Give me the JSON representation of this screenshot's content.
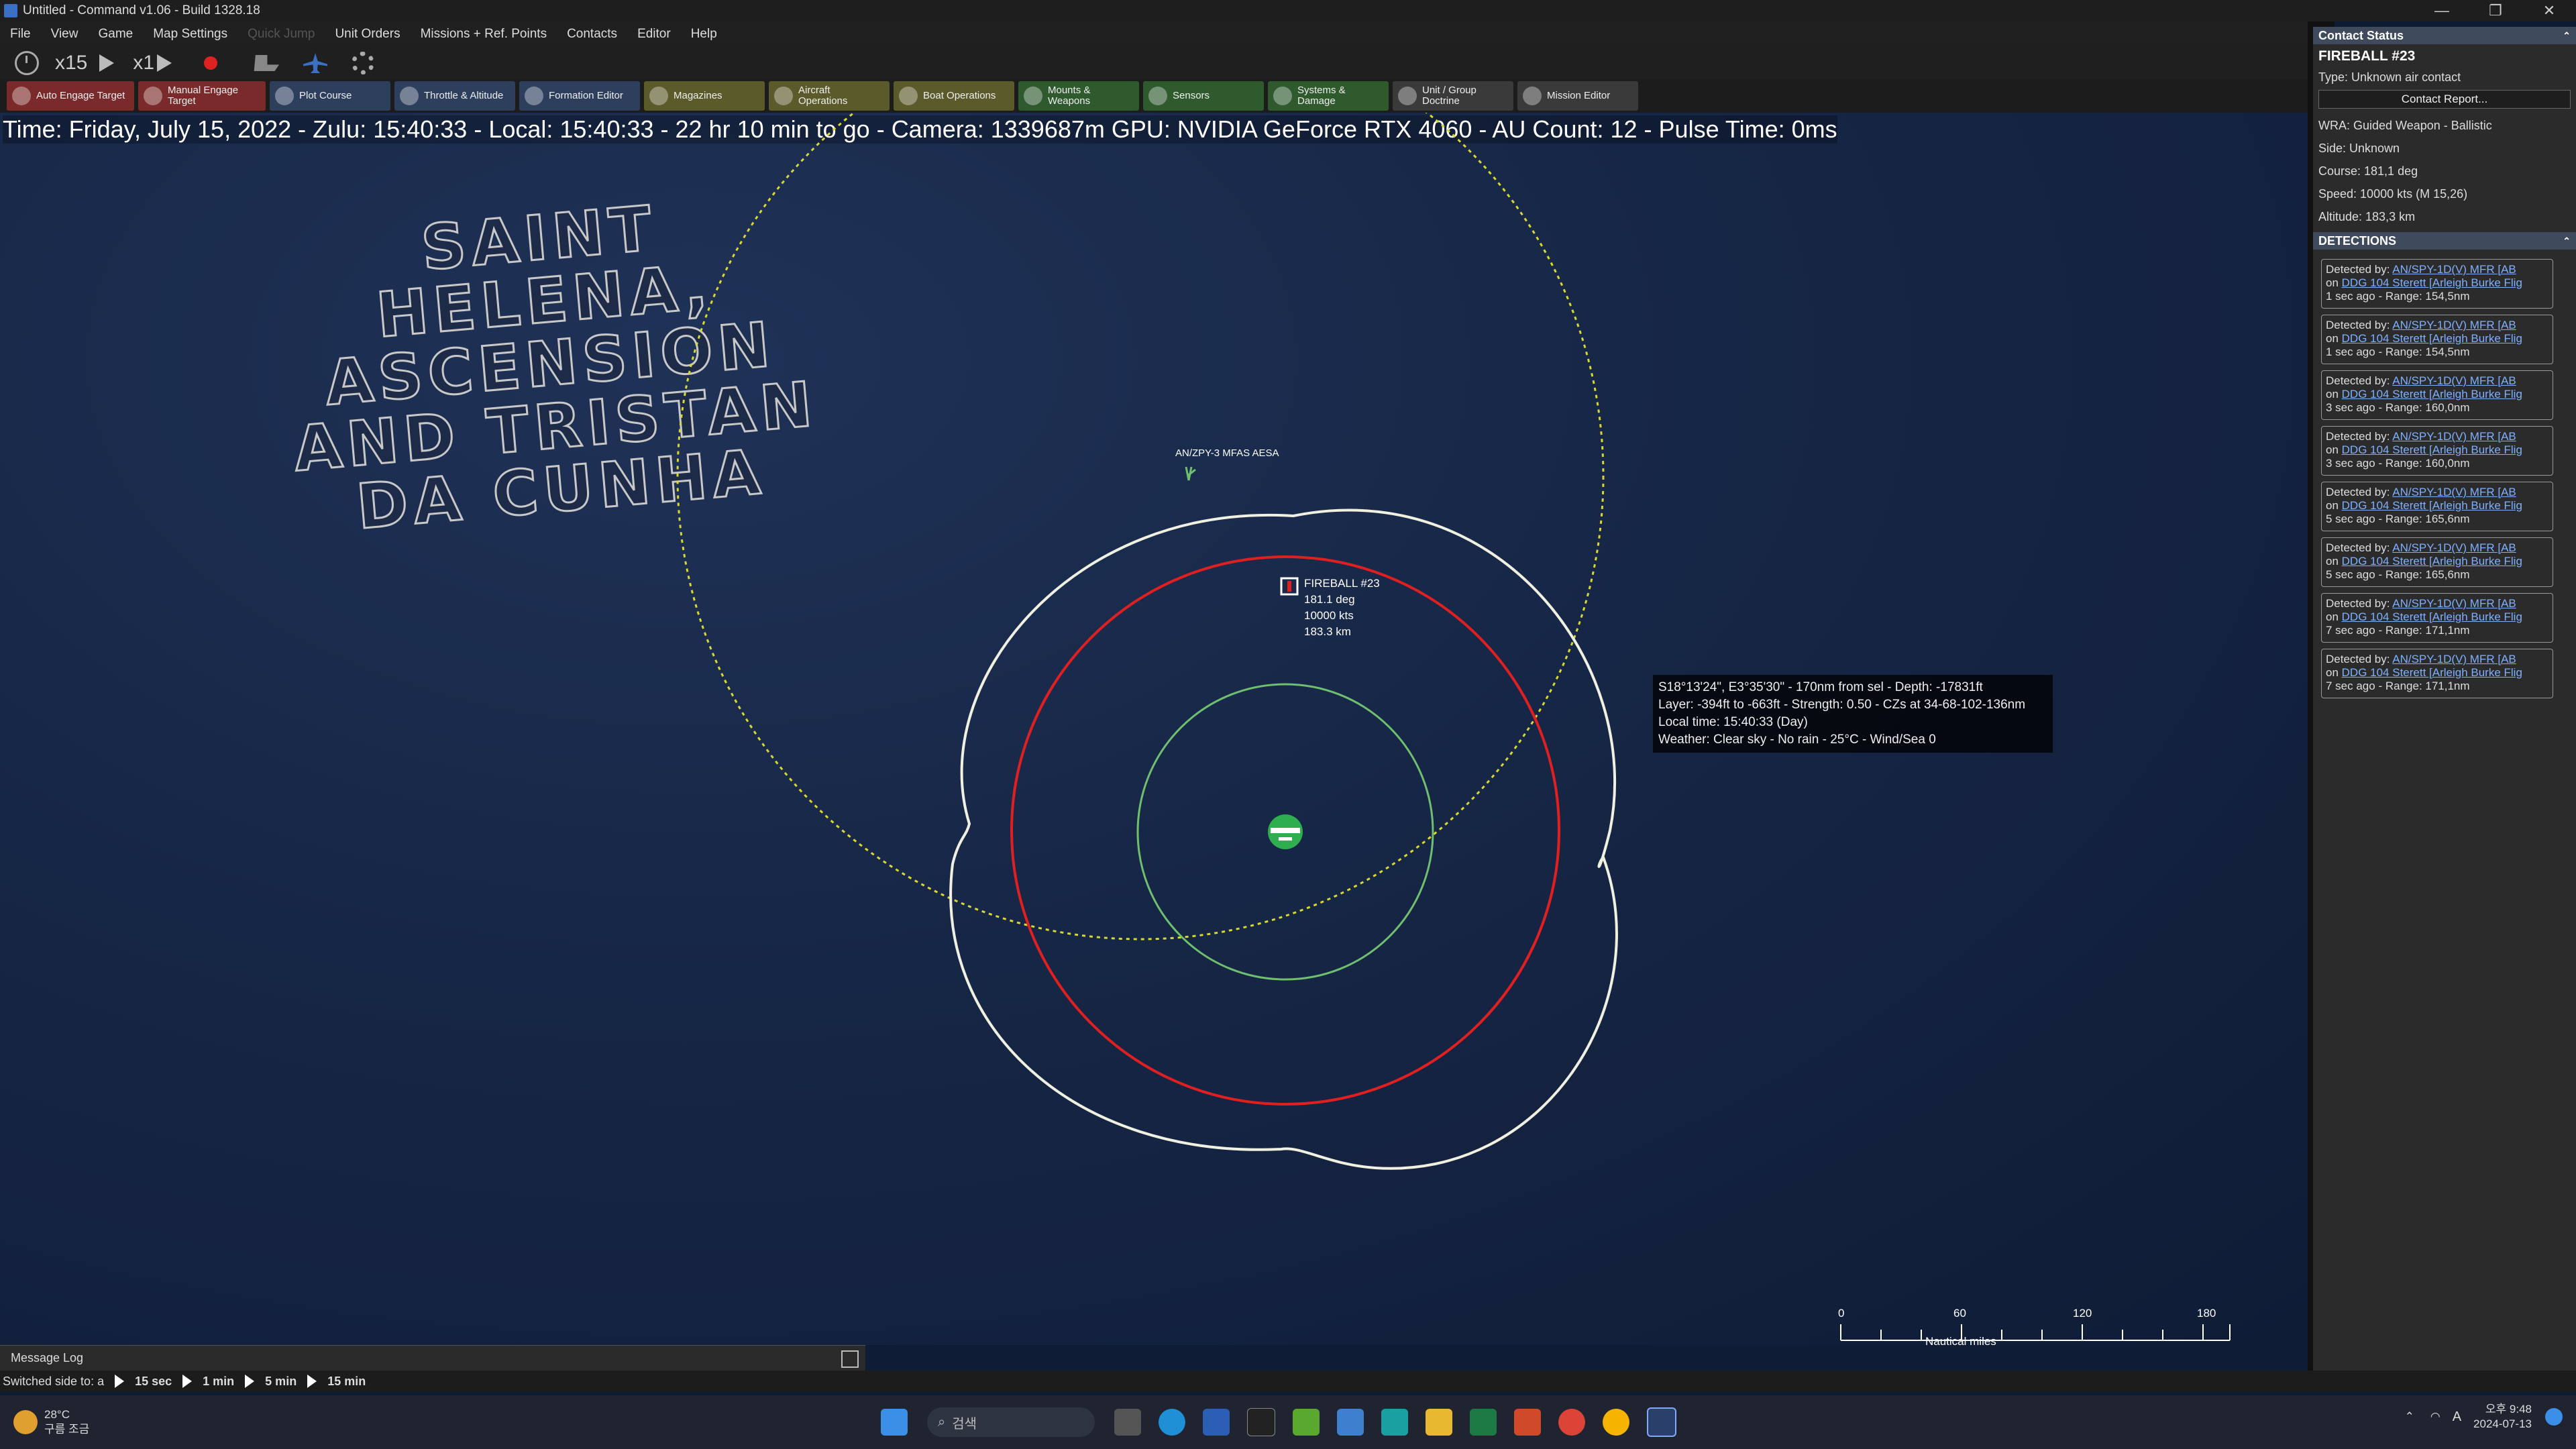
{
  "titlebar": {
    "title": "Untitled - Command v1.06 - Build 1328.18",
    "controls": [
      "—",
      "❐",
      "✕"
    ]
  },
  "menubar": {
    "items": [
      "File",
      "View",
      "Game",
      "Map Settings",
      "Quick Jump",
      "Unit Orders",
      "Missions + Ref. Points",
      "Contacts",
      "Editor",
      "Help"
    ],
    "disabled": [
      "Quick Jump"
    ]
  },
  "controls": {
    "time_compression": "x15",
    "step": "x1"
  },
  "toolbar": {
    "buttons": [
      {
        "label": "Auto Engage Target",
        "color": "red"
      },
      {
        "label": "Manual Engage Target",
        "color": "red"
      },
      {
        "label": "Plot Course",
        "color": "blue"
      },
      {
        "label": "Throttle & Altitude",
        "color": "blue"
      },
      {
        "label": "Formation Editor",
        "color": "blue"
      },
      {
        "label": "Magazines",
        "color": "olive"
      },
      {
        "label": "Aircraft Operations",
        "color": "olive"
      },
      {
        "label": "Boat Operations",
        "color": "olive"
      },
      {
        "label": "Mounts & Weapons",
        "color": "green"
      },
      {
        "label": "Sensors",
        "color": "green"
      },
      {
        "label": "Systems & Damage",
        "color": "green"
      },
      {
        "label": "Unit / Group Doctrine",
        "color": "grey"
      },
      {
        "label": "Mission Editor",
        "color": "grey"
      }
    ]
  },
  "map": {
    "status_line": "Time: Friday, July 15, 2022 - Zulu: 15:40:33 - Local: 15:40:33 - 22 hr 10 min to go -  Camera: 1339687m  GPU: NVIDIA GeForce RTX 4060 - AU Count: 12 - Pulse Time: 0ms",
    "region_label": "SAINT HELENA, ASCENSION AND TRISTAN DA CUNHA",
    "sensor_label": "AN/ZPY-3 MFAS AESA",
    "contact": {
      "name": "FIREBALL #23",
      "course": "181.1 deg",
      "speed": "10000 kts",
      "altitude": "183.3 km"
    },
    "tooltip": [
      "S18°13'24\", E3°35'30\" - 170nm from sel - Depth: -17831ft",
      "Layer: -394ft to -663ft - Strength: 0.50 - CZs at 34-68-102-136nm",
      "Local time: 15:40:33 (Day)",
      "Weather: Clear sky - No rain - 25°C - Wind/Sea 0"
    ],
    "colors": {
      "ring_white": "#f0f0e0",
      "ring_red": "#e02020",
      "ring_green": "#6fbf6f",
      "ring_yellow": "#d8d830",
      "unit_green": "#2fae4f"
    },
    "scale": {
      "ticks": [
        "0",
        "60",
        "120",
        "180"
      ],
      "unit": "Nautical miles"
    }
  },
  "message_log": {
    "title": "Message Log"
  },
  "right_panel": {
    "header": "Contact Status",
    "contact_name": "FIREBALL #23",
    "type_line": "Type: Unknown air contact",
    "report_button": "Contact Report...",
    "info": [
      "WRA: Guided Weapon - Ballistic",
      "Side: Unknown",
      "Course: 181,1 deg",
      "Speed: 10000 kts (M 15,26)",
      "Altitude: 183,3 km"
    ],
    "detections_header": "DETECTIONS",
    "detections": [
      {
        "by": "AN/SPY-1D(V) MFR [AB",
        "on": "DDG 104 Sterett [Arleigh Burke Flig",
        "when": "1 sec ago",
        "range": "Range: 154,5nm"
      },
      {
        "by": "AN/SPY-1D(V) MFR [AB",
        "on": "DDG 104 Sterett [Arleigh Burke Flig",
        "when": "1 sec ago",
        "range": "Range: 154,5nm"
      },
      {
        "by": "AN/SPY-1D(V) MFR [AB",
        "on": "DDG 104 Sterett [Arleigh Burke Flig",
        "when": "3 sec ago",
        "range": "Range: 160,0nm"
      },
      {
        "by": "AN/SPY-1D(V) MFR [AB",
        "on": "DDG 104 Sterett [Arleigh Burke Flig",
        "when": "3 sec ago",
        "range": "Range: 160,0nm"
      },
      {
        "by": "AN/SPY-1D(V) MFR [AB",
        "on": "DDG 104 Sterett [Arleigh Burke Flig",
        "when": "5 sec ago",
        "range": "Range: 165,6nm"
      },
      {
        "by": "AN/SPY-1D(V) MFR [AB",
        "on": "DDG 104 Sterett [Arleigh Burke Flig",
        "when": "5 sec ago",
        "range": "Range: 165,6nm"
      },
      {
        "by": "AN/SPY-1D(V) MFR [AB",
        "on": "DDG 104 Sterett [Arleigh Burke Flig",
        "when": "7 sec ago",
        "range": "Range: 171,1nm"
      },
      {
        "by": "AN/SPY-1D(V) MFR [AB",
        "on": "DDG 104 Sterett [Arleigh Burke Flig",
        "when": "7 sec ago",
        "range": "Range: 171,1nm"
      }
    ],
    "detected_prefix": "Detected by: ",
    "on_prefix": "on "
  },
  "bottom_bar": {
    "status": "Switched side to: a",
    "speeds": [
      "15 sec",
      "1 min",
      "5 min",
      "15 min"
    ]
  },
  "taskbar": {
    "weather_temp": "28°C",
    "weather_desc": "구름 조금",
    "search_placeholder": "검색",
    "ime": "A",
    "time": "오후 9:48",
    "date": "2024-07-13"
  }
}
